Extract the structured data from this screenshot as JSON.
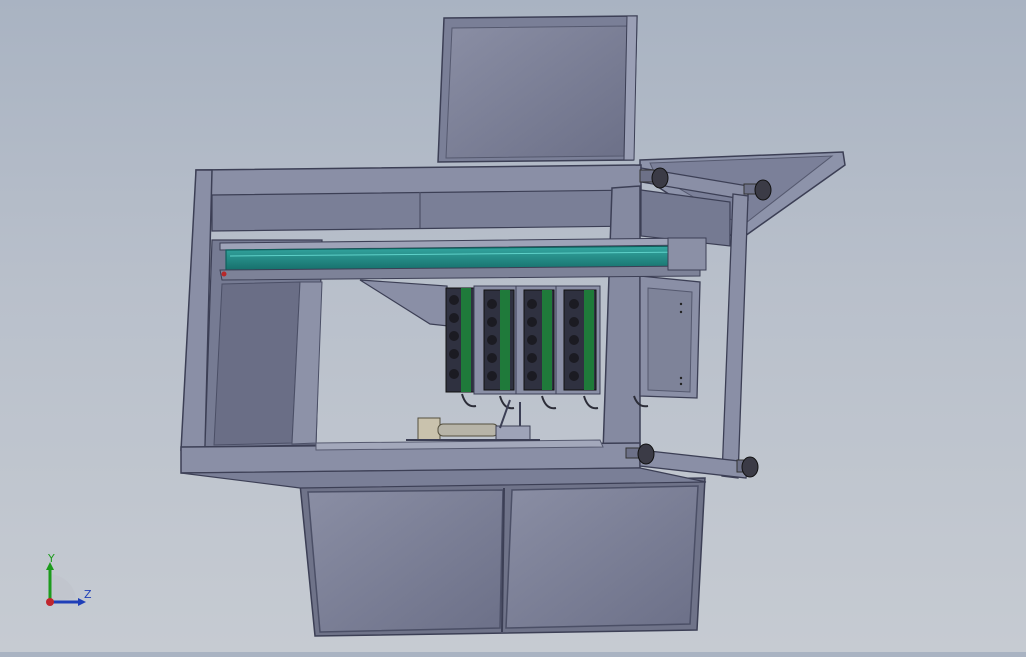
{
  "scene": {
    "description_hidden": "",
    "colors": {
      "background_top": "#a9b3c2",
      "background_bottom": "#c6cbd2",
      "frame": "#7a7f97",
      "frame_dark": "#5d6178",
      "frame_light": "#9a9fb5",
      "panel": "#7c8096",
      "rail": "#1e8b86",
      "rail_dark": "#0f5f5c",
      "board": "#1f7a3a",
      "knob": "#3b3b46",
      "cabinet": "#80849a"
    }
  },
  "triad": {
    "y_label": "Y",
    "z_label": "Z",
    "y_color": "#1c9b1c",
    "z_color": "#1f3fb8",
    "x_color": "#c0262d"
  }
}
